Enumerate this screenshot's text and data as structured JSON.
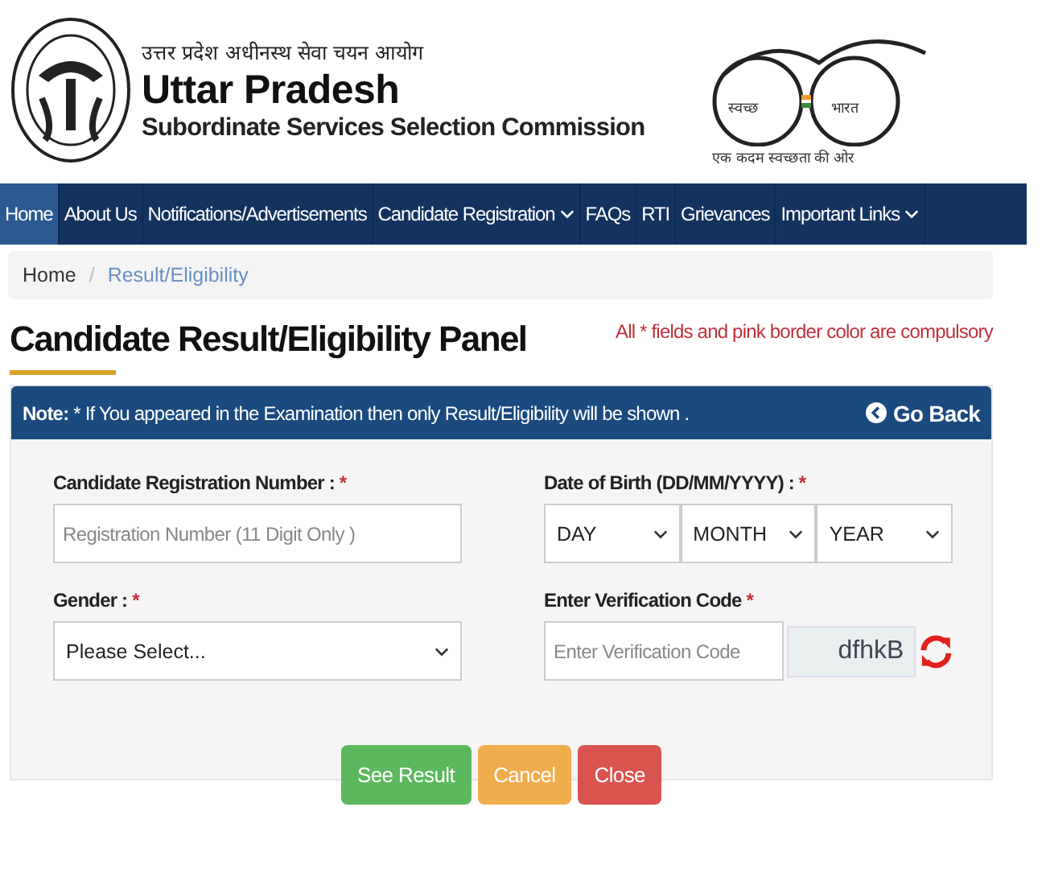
{
  "header": {
    "hindi_name": "उत्तर प्रदेश अधीनस्थ सेवा चयन आयोग",
    "title": "Uttar Pradesh",
    "subtitle": "Subordinate Services Selection Commission",
    "swachh_left": "स्वच्छ",
    "swachh_right": "भारत",
    "swachh_tagline": "एक कदम स्वच्छता की ओर"
  },
  "nav": [
    {
      "label": "Home",
      "selected": true,
      "dropdown": false
    },
    {
      "label": "About Us",
      "selected": false,
      "dropdown": false
    },
    {
      "label": "Notifications/Advertisements",
      "selected": false,
      "dropdown": false
    },
    {
      "label": "Candidate Registration",
      "selected": false,
      "dropdown": true
    },
    {
      "label": "FAQs",
      "selected": false,
      "dropdown": false
    },
    {
      "label": "RTI",
      "selected": false,
      "dropdown": false
    },
    {
      "label": "Grievances",
      "selected": false,
      "dropdown": false
    },
    {
      "label": "Important Links",
      "selected": false,
      "dropdown": true
    }
  ],
  "breadcrumb": [
    "Home",
    "Result/Eligibility"
  ],
  "breadcrumb_separator": "/",
  "page_title": "Candidate Result/Eligibility Panel",
  "compulsory_note": "All * fields and pink border color are compulsory",
  "panel": {
    "note_label": "Note:",
    "note": "* If You appeared in the Examination then only Result/Eligibility will be shown .",
    "go_back": "Go Back"
  },
  "form": {
    "registration": {
      "label": "Candidate Registration Number :",
      "required": "*",
      "placeholder": "Registration Number (11 Digit Only )"
    },
    "dob": {
      "label": "Date of Birth (DD/MM/YYYY) :",
      "required": "*",
      "selects": [
        "DAY",
        "MONTH",
        "YEAR"
      ]
    },
    "gender": {
      "label": "Gender :",
      "required": "*",
      "value": "Please Select..."
    },
    "captcha": {
      "label": "Enter Verification Code",
      "required": "*",
      "placeholder": "Enter Verification Code",
      "code": "dfhkB"
    }
  },
  "buttons": [
    {
      "label": "See Result",
      "kind": "success"
    },
    {
      "label": "Cancel",
      "kind": "warning"
    },
    {
      "label": "Close",
      "kind": "danger"
    }
  ]
}
